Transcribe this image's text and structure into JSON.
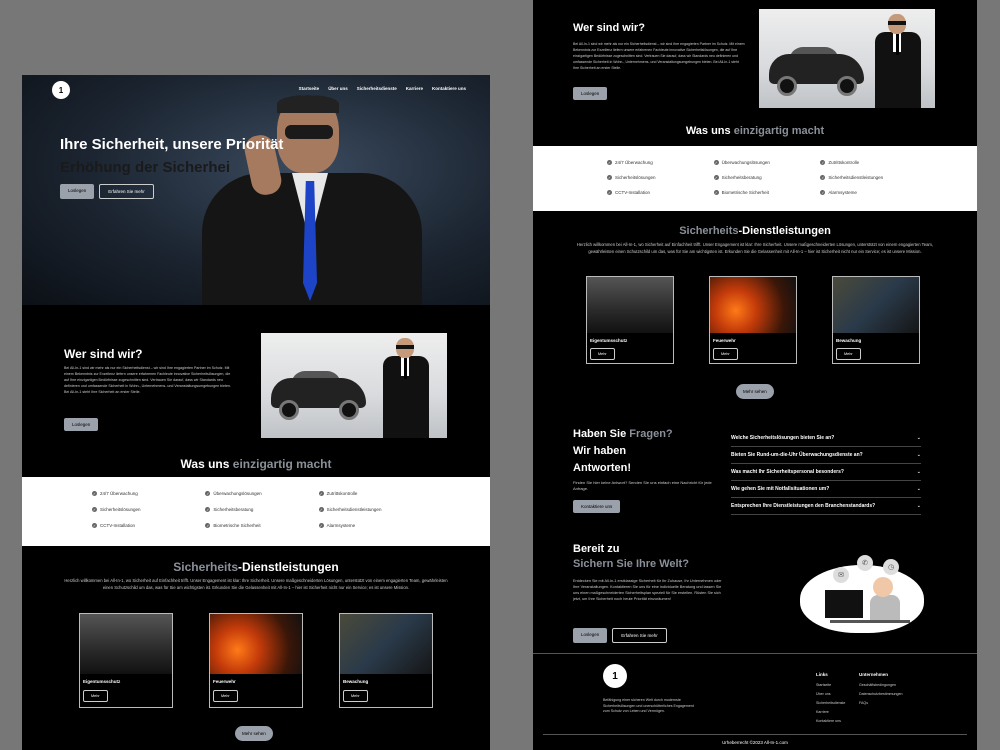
{
  "site": {
    "logo": "1"
  },
  "nav": [
    "Startseite",
    "Über uns",
    "Sicherheitsdienste",
    "Karriere",
    "Kontaktiere uns"
  ],
  "hero": {
    "title": "Ihre Sicherheit, unsere Priorität",
    "subtitle": "Erhöhung der Sicherhei",
    "btn_primary": "Loslegen",
    "btn_secondary": "Erfahren Sie mehr"
  },
  "about": {
    "title": "Wer sind wir?",
    "text": "Bei All-In-1 sind wir mehr als nur ein Sicherheitsdienst – wir sind Ihre engagierten Partner im Schutz. Mit einem Bekenntnis zur Exzellenz liefern unsere erfahrenen Fachleute innovative Sicherheitslösungen, die auf Ihre einzigartigen Bedürfnisse zugeschnitten sind. Vertrauen Sie darauf, dass wir Standards neu definieren und umfassende Sicherheit in Wohn-, Unternehmens- und Veranstaltungsumgebungen bieten. Bei All-In-1 steht Ihre Sicherheit an erster Stelle.",
    "btn": "Loslegen"
  },
  "unique": {
    "title_a": "Was uns",
    "title_b": "einzigartig macht",
    "features": [
      "24/7 Überwachung",
      "Überwachungslösungen",
      "Zutrittskontrolle",
      "Sicherheitslösungen",
      "Sicherheitsberatung",
      "Sicherheitsdienstleistungen",
      "CCTV-Installation",
      "Biometrische Sicherheit",
      "Alarmsysteme"
    ]
  },
  "services": {
    "title_a": "Sicherheits",
    "title_b": "-Dienstleistungen",
    "text": "Herzlich willkommen bei All-In-1, wo Sicherheit auf Einfachheit trifft. Unser Engagement ist klar: Ihre Sicherheit. Unsere maßgeschneiderten Lösungen, unterstützt von einem engagierten Team, gewährleisten einen Schutzschild um das, was für Sie am wichtigsten ist. Erkunden Sie die Gelassenheit mit All-In-1 – hier ist Sicherheit nicht nur ein Service; es ist unsere Mission.",
    "cards": [
      {
        "title": "Eigentumsschutz",
        "btn": "Mehr"
      },
      {
        "title": "Feuerwehr",
        "btn": "Mehr"
      },
      {
        "title": "Bewachung",
        "btn": "Mehr"
      }
    ],
    "more": "Mehr sehen"
  },
  "faq": {
    "line1_a": "Haben Sie",
    "line1_b": "Fragen?",
    "line2": "Wir haben",
    "line3": "Antworten!",
    "sub": "Finden Sie hier keine Antwort? Senden Sie uns einfach eine Nachricht für jede Anfrage.",
    "btn": "Kontaktiere uns",
    "items": [
      "Welche Sicherheitslösungen bieten Sie an?",
      "Bieten Sie Rund-um-die-Uhr Überwachungsdienste an?",
      "Was macht Ihr Sicherheitspersonal besonders?",
      "Wie gehen Sie mit Notfallsituationen um?",
      "Entsprechen Ihre Dienstleistungen den Branchenstandards?"
    ]
  },
  "ready": {
    "line1": "Bereit zu",
    "line2": "Sichern Sie Ihre Welt?",
    "text": "Entdecken Sie mit All-In-1 erstklassige Sicherheit für Ihr Zuhause, Ihr Unternehmen oder Ihre Veranstaltungen. Kontaktieren Sie uns für eine individuelle Beratung und lassen Sie uns einen maßgeschneiderten Sicherheitsplan speziell für Sie erstellen. Rüsten Sie sich jetzt, um Ihre Sicherheit noch heute Priorität einzuräumen!",
    "btn_primary": "Loslegen",
    "btn_secondary": "Erfahren Sie mehr"
  },
  "footer": {
    "text": "Befähigung einer sicheren Welt durch modernste Sicherheitslösungen und unerschütterliches Engagement zum Schutz von Leben und Vermögen.",
    "links_title": "Links",
    "links": [
      "Startseite",
      "Über uns",
      "Sicherheitsdienste",
      "Karriere",
      "Kontaktiere uns"
    ],
    "company_title": "Unternehmen",
    "company": [
      "Geschäftsbedingungen",
      "Datenschutzbestimmungen",
      "FAQs"
    ],
    "copyright": "Urheberrecht ©2023 All-In-1.com"
  },
  "colors": {
    "accent": "#8a9099",
    "button": "#9aa1aa",
    "tie": "#1d44c6"
  }
}
